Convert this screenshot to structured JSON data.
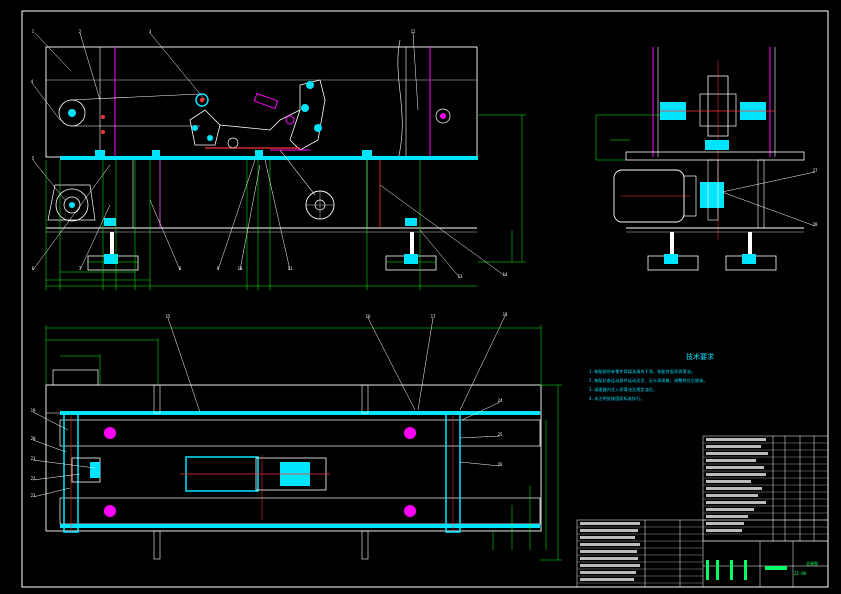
{
  "colors": {
    "background": "#000000",
    "outline": "#ffffff",
    "part": "#00e5ff",
    "dimension": "#00ff00",
    "leader": "#ffffff",
    "axis": "#ff3333",
    "accent": "#ff00ff",
    "text": "#00e0ff",
    "titleblock_id": "#00ff66"
  },
  "technical_requirements": {
    "title": "技术要求",
    "lines": [
      "1.装配前所有零件用煤油清洗干净，各配合面涂润滑油。",
      "2.装配后各运动部件运动灵活，无卡滞现象，调整到位后锁紧。",
      "3.减速器内注入润滑油至规定油位。",
      "4.未注明处按国家标准执行。"
    ]
  },
  "balloons": [
    {
      "label": "1"
    },
    {
      "label": "2"
    },
    {
      "label": "3"
    },
    {
      "label": "4"
    },
    {
      "label": "5"
    },
    {
      "label": "6"
    },
    {
      "label": "7"
    },
    {
      "label": "8"
    },
    {
      "label": "9"
    },
    {
      "label": "10"
    },
    {
      "label": "11"
    },
    {
      "label": "12"
    },
    {
      "label": "13"
    },
    {
      "label": "14"
    },
    {
      "label": "15"
    },
    {
      "label": "16"
    },
    {
      "label": "17"
    },
    {
      "label": "18"
    },
    {
      "label": "19"
    },
    {
      "label": "20"
    },
    {
      "label": "21"
    },
    {
      "label": "22"
    },
    {
      "label": "23"
    },
    {
      "label": "24"
    },
    {
      "label": "25"
    },
    {
      "label": "26"
    },
    {
      "label": "27"
    },
    {
      "label": "28"
    }
  ],
  "title_block": {
    "drawing_name": "总装图",
    "drawing_id": "ZZ-00"
  }
}
